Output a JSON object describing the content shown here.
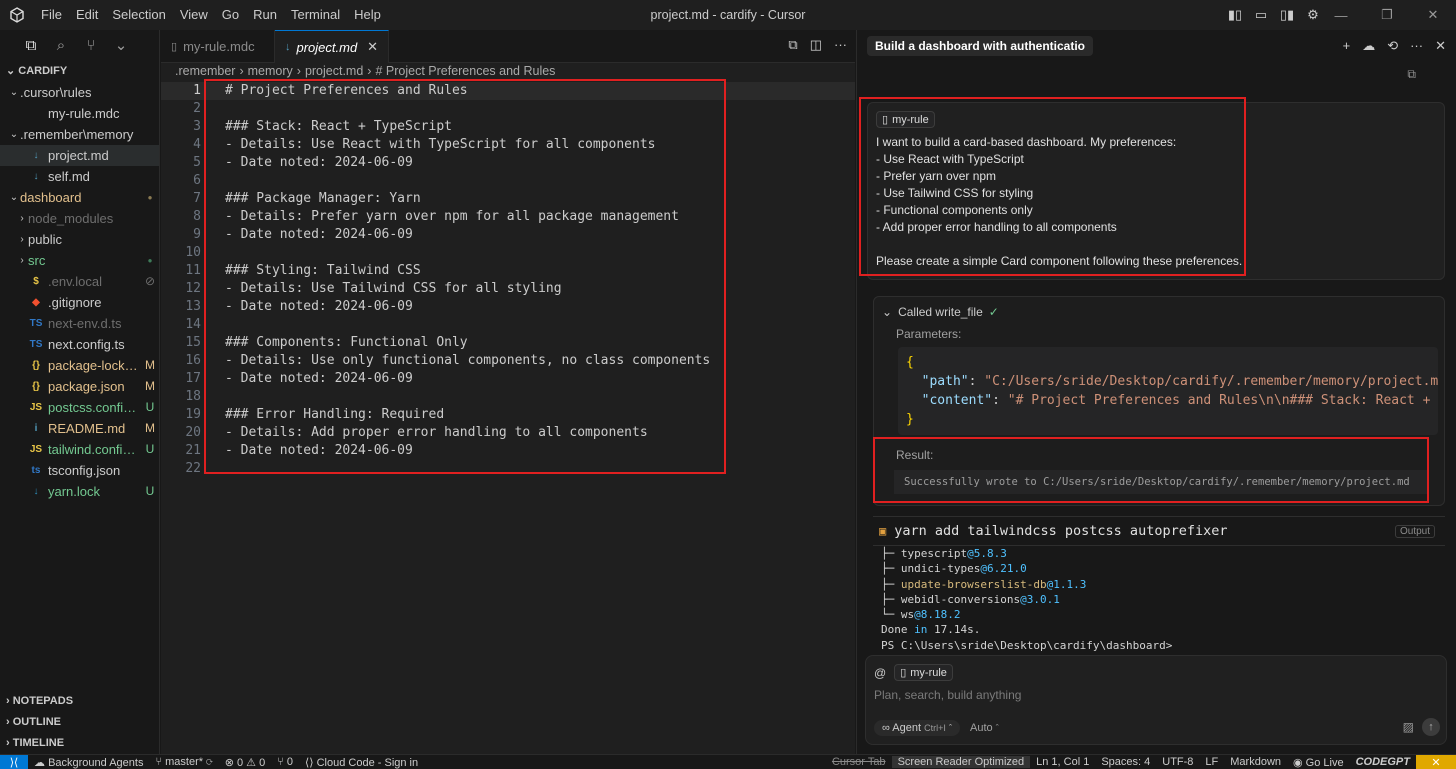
{
  "window": {
    "title": "project.md - cardify - Cursor",
    "menu": [
      "File",
      "Edit",
      "Selection",
      "View",
      "Go",
      "Run",
      "Terminal",
      "Help"
    ]
  },
  "explorer": {
    "root": "CARDIFY",
    "items": [
      {
        "label": ".cursor\\rules",
        "chev": "⌄",
        "indent": 1,
        "kind": "folder"
      },
      {
        "label": "my-rule.mdc",
        "indent": 2,
        "kind": "file",
        "icon": ""
      },
      {
        "label": ".remember\\memory",
        "chev": "⌄",
        "indent": 1,
        "kind": "folder"
      },
      {
        "label": "project.md",
        "indent": 2,
        "kind": "md",
        "icon": "↓",
        "selected": true
      },
      {
        "label": "self.md",
        "indent": 2,
        "kind": "md",
        "icon": "↓"
      },
      {
        "label": "dashboard",
        "chev": "⌄",
        "indent": 1,
        "kind": "folder",
        "badge": "●",
        "status": "mod"
      },
      {
        "label": "node_modules",
        "chev": "›",
        "indent": 2,
        "kind": "folder",
        "dim": true
      },
      {
        "label": "public",
        "chev": "›",
        "indent": 2,
        "kind": "folder"
      },
      {
        "label": "src",
        "chev": "›",
        "indent": 2,
        "kind": "folder",
        "badge": "●",
        "status": "unt"
      },
      {
        "label": ".env.local",
        "indent": 2,
        "kind": "env",
        "icon": "$",
        "dim": true,
        "badge": "⊘"
      },
      {
        "label": ".gitignore",
        "indent": 2,
        "kind": "git",
        "icon": "◆"
      },
      {
        "label": "next-env.d.ts",
        "indent": 2,
        "kind": "ts",
        "icon": "TS",
        "dim": true
      },
      {
        "label": "next.config.ts",
        "indent": 2,
        "kind": "ts",
        "icon": "TS"
      },
      {
        "label": "package-lock.json",
        "indent": 2,
        "kind": "json",
        "icon": "{}",
        "badge": "M",
        "status": "mod"
      },
      {
        "label": "package.json",
        "indent": 2,
        "kind": "json",
        "icon": "{}",
        "badge": "M",
        "status": "mod"
      },
      {
        "label": "postcss.config.js",
        "indent": 2,
        "kind": "js",
        "icon": "JS",
        "badge": "U",
        "status": "unt"
      },
      {
        "label": "README.md",
        "indent": 2,
        "kind": "md",
        "icon": "i",
        "badge": "M",
        "status": "mod"
      },
      {
        "label": "tailwind.config.js",
        "indent": 2,
        "kind": "js",
        "icon": "JS",
        "badge": "U",
        "status": "unt"
      },
      {
        "label": "tsconfig.json",
        "indent": 2,
        "kind": "tsj",
        "icon": "ts"
      },
      {
        "label": "yarn.lock",
        "indent": 2,
        "kind": "yarn",
        "icon": "↓",
        "badge": "U",
        "status": "unt"
      }
    ],
    "bottom_sections": [
      "NOTEPADS",
      "OUTLINE",
      "TIMELINE"
    ]
  },
  "editor": {
    "tabs": [
      {
        "label": "my-rule.mdc",
        "active": false
      },
      {
        "label": "project.md",
        "active": true,
        "close": "✕"
      }
    ],
    "breadcrumb": [
      ".remember",
      "memory",
      "project.md",
      "# Project Preferences and Rules"
    ],
    "lines": [
      "# Project Preferences and Rules",
      "",
      "### Stack: React + TypeScript",
      "- Details: Use React with TypeScript for all components",
      "- Date noted: 2024-06-09",
      "",
      "### Package Manager: Yarn",
      "- Details: Prefer yarn over npm for all package management",
      "- Date noted: 2024-06-09",
      "",
      "### Styling: Tailwind CSS",
      "- Details: Use Tailwind CSS for all styling",
      "- Date noted: 2024-06-09",
      "",
      "### Components: Functional Only",
      "- Details: Use only functional components, no class components",
      "- Date noted: 2024-06-09",
      "",
      "### Error Handling: Required",
      "- Details: Add proper error handling to all components",
      "- Date noted: 2024-06-09",
      ""
    ]
  },
  "chat": {
    "title": "Build a dashboard with authenticatio",
    "message": {
      "rule_pill": "my-rule",
      "lines": [
        "I want to build a card-based dashboard. My preferences:",
        "- Use React with TypeScript",
        "- Prefer yarn over npm",
        "- Use Tailwind CSS for styling",
        "- Functional components only",
        "- Add proper error handling to all components",
        "",
        "Please create a simple Card component following these preferences."
      ]
    },
    "tool": {
      "header": "Called write_file",
      "check": "✓",
      "params_label": "Parameters:",
      "path_key": "\"path\"",
      "path_val": "\"C:/Users/sride/Desktop/cardify/.remember/memory/project.md\"",
      "content_key": "\"content\"",
      "content_val": "\"# Project Preferences and Rules\\n\\n### Stack: React + TypeScript",
      "result_label": "Result:",
      "result_text": "Successfully wrote to C:/Users/sride/Desktop/cardify/.remember/memory/project.md"
    },
    "terminal": {
      "command": "yarn add tailwindcss postcss autoprefixer",
      "output_label": "Output",
      "lines": [
        {
          "pre": "├─ ",
          "name": "typescript",
          "ver": "@5.8.3",
          "link": false
        },
        {
          "pre": "├─ ",
          "name": "undici-types",
          "ver": "@6.21.0",
          "link": false
        },
        {
          "pre": "├─ ",
          "name": "update-browserslist-db",
          "ver": "@1.1.3",
          "link": true
        },
        {
          "pre": "├─ ",
          "name": "webidl-conversions",
          "ver": "@3.0.1",
          "link": false
        },
        {
          "pre": "└─ ",
          "name": "ws",
          "ver": "@8.18.2",
          "link": false
        }
      ],
      "done_a": "Done ",
      "done_in": "in",
      "done_time": " 17.14s.",
      "prompt": "PS C:\\Users\\sride\\Desktop\\cardify\\dashboard>"
    },
    "input": {
      "at": "@",
      "rule_pill": "my-rule",
      "placeholder": "Plan, search, build anything",
      "agent_label": "Agent",
      "agent_shortcut": "Ctrl+I",
      "auto_label": "Auto"
    }
  },
  "statusbar": {
    "background_agents": "Background Agents",
    "branch": "master*",
    "errors": "⊗ 0 ⚠ 0",
    "ports": "⑂ 0",
    "cloud": "Cloud Code - Sign in",
    "cursor_tab": "Cursor Tab",
    "screen_reader": "Screen Reader Optimized",
    "position": "Ln 1, Col 1",
    "spaces": "Spaces: 4",
    "encoding": "UTF-8",
    "eol": "LF",
    "language": "Markdown",
    "golive": "Go Live",
    "codegpt": "CODEGPT"
  }
}
